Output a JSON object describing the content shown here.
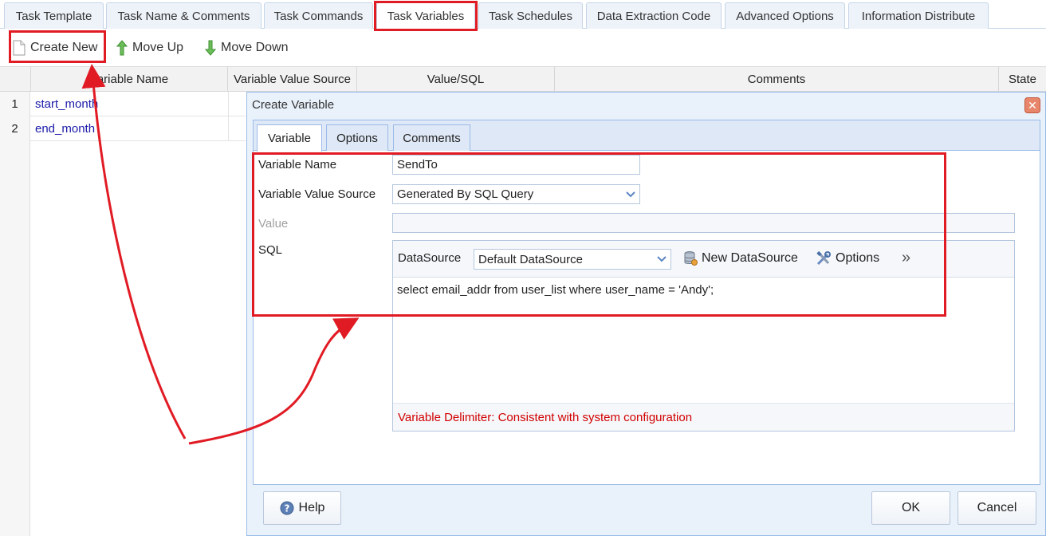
{
  "tabs": [
    {
      "label": "Task Template"
    },
    {
      "label": "Task Name & Comments"
    },
    {
      "label": "Task Commands"
    },
    {
      "label": "Task Variables"
    },
    {
      "label": "Task Schedules"
    },
    {
      "label": "Data Extraction Code"
    },
    {
      "label": "Advanced Options"
    },
    {
      "label": "Information Distribute"
    }
  ],
  "active_tab": "Task Variables",
  "toolbar": {
    "create_new": "Create New",
    "move_up": "Move Up",
    "move_down": "Move Down"
  },
  "grid": {
    "columns": [
      "Variable Name",
      "Variable Value Source",
      "Value/SQL",
      "Comments",
      "State"
    ],
    "rows": [
      {
        "num": "1",
        "name": "start_month"
      },
      {
        "num": "2",
        "name": "end_month"
      }
    ]
  },
  "dialog": {
    "title": "Create Variable",
    "tabs": [
      {
        "label": "Variable"
      },
      {
        "label": "Options"
      },
      {
        "label": "Comments"
      }
    ],
    "fields": {
      "variable_name_label": "Variable Name",
      "variable_name_value": "SendTo",
      "value_source_label": "Variable Value Source",
      "value_source_value": "Generated By SQL Query",
      "value_label": "Value",
      "value_value": "",
      "sql_label": "SQL"
    },
    "sql": {
      "datasource_label": "DataSource",
      "datasource_value": "Default DataSource",
      "new_datasource": "New DataSource",
      "options": "Options",
      "more": "»",
      "query": "select email_addr from user_list where user_name = 'Andy';",
      "delimiter_note": "Variable Delimiter: Consistent with system configuration"
    },
    "footer": {
      "help": "Help",
      "ok": "OK",
      "cancel": "Cancel"
    }
  },
  "colors": {
    "highlight": "#e11b24",
    "link": "#1a1aa8",
    "note": "#d10000"
  }
}
